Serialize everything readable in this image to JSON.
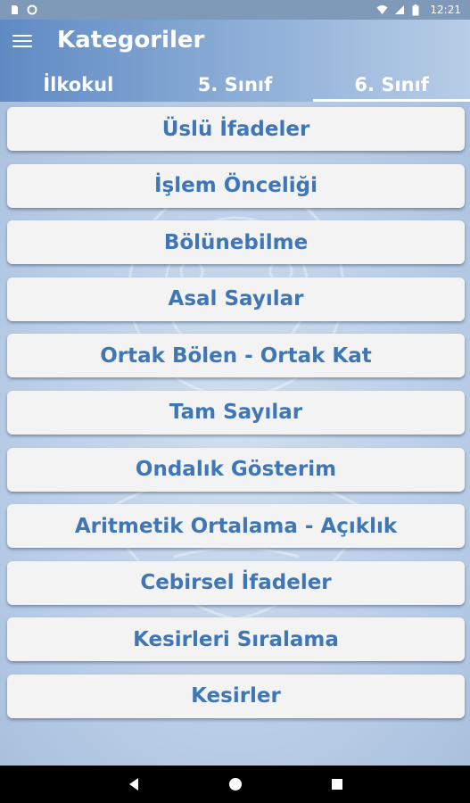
{
  "status_bar": {
    "time": "12:21"
  },
  "app_bar": {
    "title": "Kategoriler"
  },
  "tabs": [
    {
      "label": "İlkokul",
      "active": false
    },
    {
      "label": "5. Sınıf",
      "active": false
    },
    {
      "label": "6. Sınıf",
      "active": true
    }
  ],
  "categories": [
    "Üslü İfadeler",
    "İşlem Önceliği",
    "Bölünebilme",
    "Asal Sayılar",
    "Ortak Bölen - Ortak Kat",
    "Tam Sayılar",
    "Ondalık Gösterim",
    "Aritmetik Ortalama - Açıklık",
    "Cebirsel İfadeler",
    "Kesirleri Sıralama",
    "Kesirler"
  ],
  "colors": {
    "accent": "#3f76b5",
    "app_bar_start": "#5f8ac3",
    "app_bar_end": "#b8cde6"
  }
}
